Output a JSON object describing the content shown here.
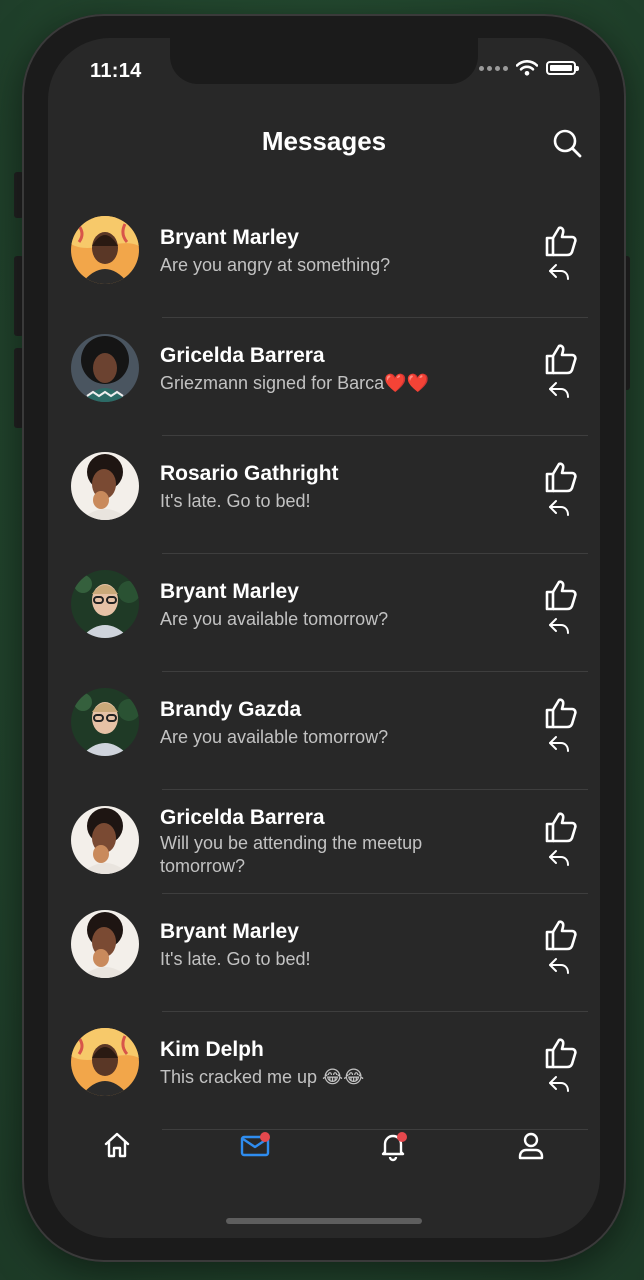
{
  "status_bar": {
    "time": "11:14"
  },
  "header": {
    "title": "Messages"
  },
  "messages": [
    {
      "name": "Bryant Marley",
      "text": "Are you angry at something?",
      "avatar": "avatar-1"
    },
    {
      "name": "Gricelda Barrera",
      "text": "Griezmann signed for Barca❤️❤️",
      "avatar": "avatar-2"
    },
    {
      "name": "Rosario Gathright",
      "text": "It's late. Go to bed!",
      "avatar": "avatar-3"
    },
    {
      "name": "Bryant Marley",
      "text": "Are you available tomorrow?",
      "avatar": "avatar-4"
    },
    {
      "name": "Brandy Gazda",
      "text": "Are you available tomorrow?",
      "avatar": "avatar-4"
    },
    {
      "name": "Gricelda Barrera",
      "text": "Will you be attending the meetup tomorrow?",
      "avatar": "avatar-3"
    },
    {
      "name": "Bryant Marley",
      "text": "It's late. Go to bed!",
      "avatar": "avatar-3"
    },
    {
      "name": "Kim Delph",
      "text": "This cracked me up 😂😂",
      "avatar": "avatar-1"
    }
  ],
  "tabbar": {
    "items": [
      {
        "name": "home",
        "icon": "home-icon",
        "active": false
      },
      {
        "name": "messages",
        "icon": "mail-icon",
        "active": true,
        "badge": true
      },
      {
        "name": "notifications",
        "icon": "bell-icon",
        "active": false,
        "badge": true
      },
      {
        "name": "profile",
        "icon": "person-icon",
        "active": false
      }
    ]
  },
  "colors": {
    "background": "#282828",
    "accent": "#2f8df0",
    "badge": "#e5484d",
    "text_secondary": "#c2c2c2"
  }
}
